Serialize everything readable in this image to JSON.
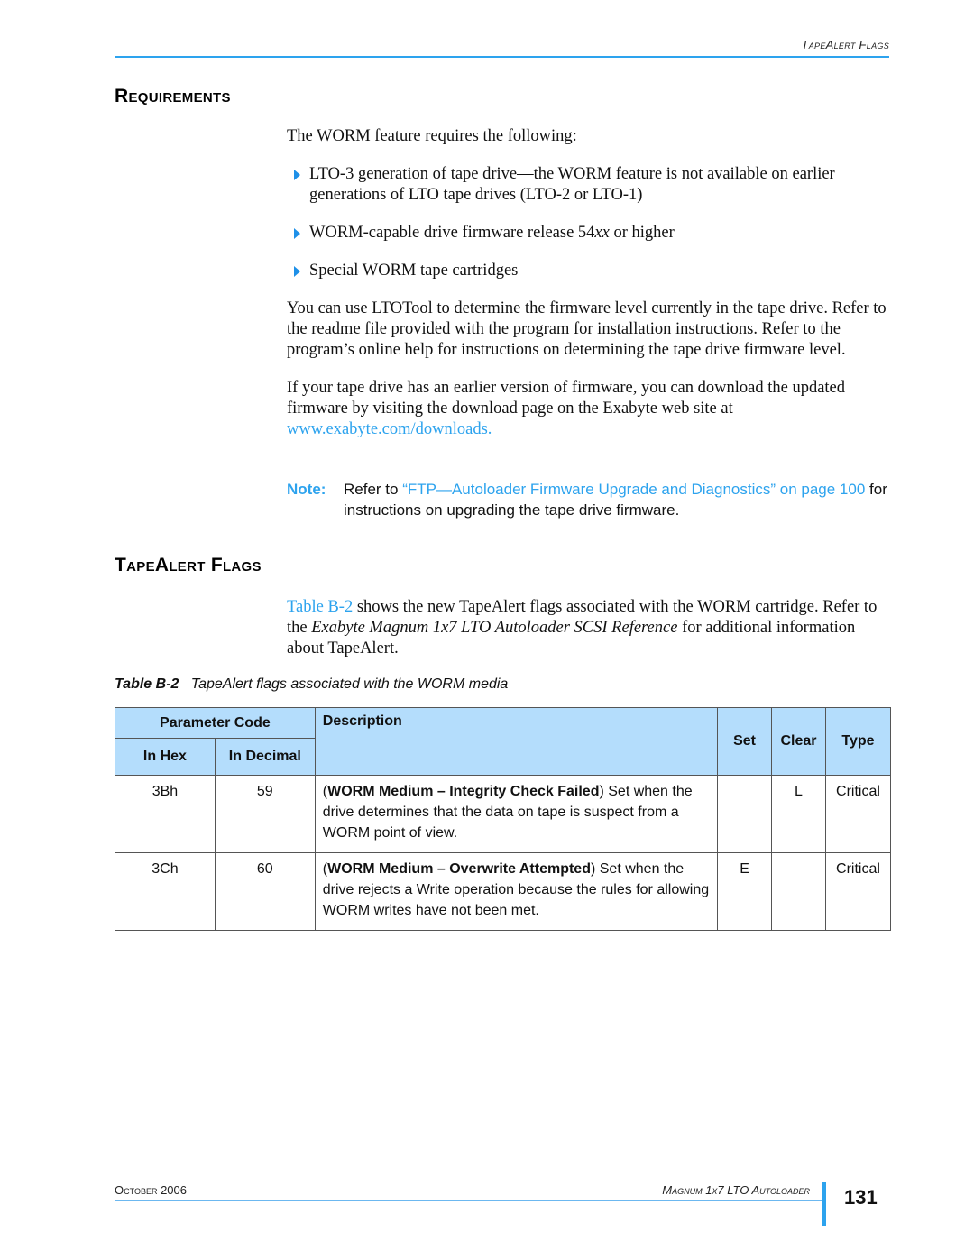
{
  "header": {
    "running_title": "TapeAlert Flags"
  },
  "requirements": {
    "heading": "Requirements",
    "intro": "The WORM feature requires the following:",
    "bullets": [
      "LTO-3 generation of tape drive—the WORM feature is not available on earlier generations of LTO tape drives (LTO-2 or LTO-1)",
      "WORM-capable drive firmware release 54xx or higher",
      "Special WORM tape cartridges"
    ],
    "bullet2_prefix": "WORM-capable drive firmware release 54",
    "bullet2_italic": "xx",
    "bullet2_suffix": " or higher",
    "para1": "You can use LTOTool to determine the firmware level currently in the tape drive. Refer to the readme file provided with the program for installation instructions. Refer to the program’s online help for instructions on determining the tape drive firmware level.",
    "para2": "If your tape drive has an earlier version of firmware, you can download the updated firmware by visiting the download page on the Exabyte web site at ",
    "para2_link": "www.exabyte.com/downloads."
  },
  "note": {
    "label": "Note:",
    "prefix": "Refer to ",
    "link": "“FTP—Autoloader Firmware Upgrade and Diagnostics” on page 100",
    "suffix": " for instructions on upgrading the tape drive firmware."
  },
  "tapealert": {
    "heading": "TapeAlert Flags",
    "intro_link": "Table B-2",
    "intro_text1": " shows the new TapeAlert flags associated with the WORM cartridge. Refer to the ",
    "intro_italic": "Exabyte Magnum 1x7 LTO Autoloader SCSI Reference",
    "intro_text2": " for additional information about TapeAlert."
  },
  "table": {
    "caption_label": "Table B-2",
    "caption_text": "TapeAlert flags associated with the WORM media",
    "headers": {
      "parameter_code": "Parameter Code",
      "in_hex": "In Hex",
      "in_decimal": "In Decimal",
      "description": "Description",
      "set": "Set",
      "clear": "Clear",
      "type": "Type"
    },
    "rows": [
      {
        "hex": "3Bh",
        "decimal": "59",
        "desc_bold": "WORM Medium – Integrity Check Failed",
        "desc_text": " Set when the drive determines that the data on tape is suspect from a WORM point of view.",
        "set": "",
        "clear": "L",
        "type": "Critical"
      },
      {
        "hex": "3Ch",
        "decimal": "60",
        "desc_bold": "WORM Medium – Overwrite Attempted",
        "desc_text": " Set when the drive rejects a Write operation because the rules for allowing WORM writes have not been met.",
        "set": "E",
        "clear": "",
        "type": "Critical"
      }
    ]
  },
  "footer": {
    "date": "October 2006",
    "product": "Magnum 1x7 LTO Autoloader",
    "page_number": "131"
  },
  "colors": {
    "accent": "#2da3ee",
    "table_header": "#b4ddfc"
  }
}
